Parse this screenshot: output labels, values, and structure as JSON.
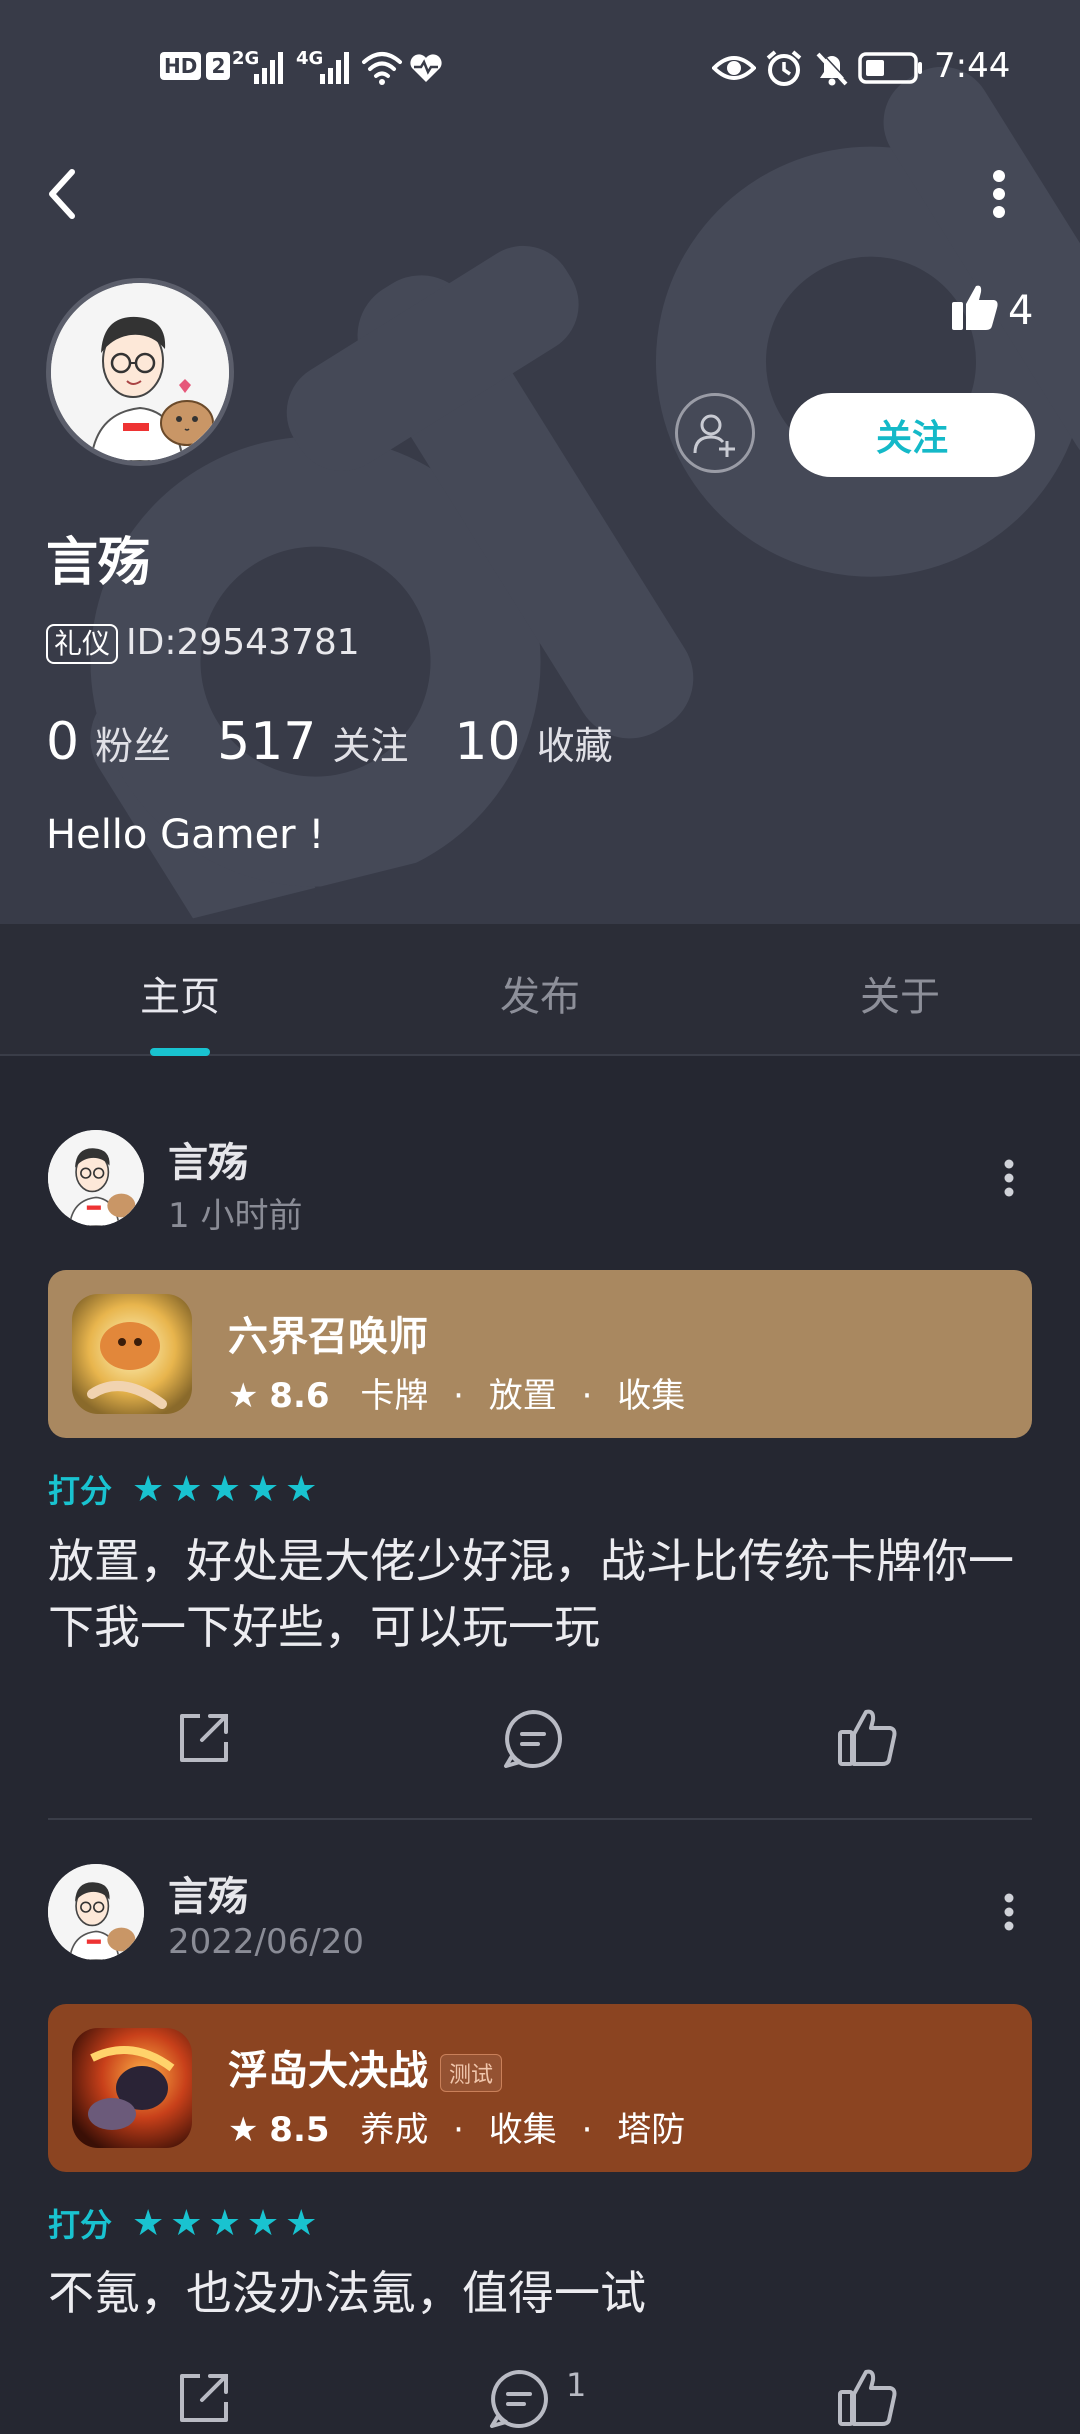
{
  "status_bar": {
    "hd_label": "HD",
    "hd_sub": "2",
    "net1": "2G",
    "net2": "4G",
    "time": "7:44"
  },
  "profile": {
    "name": "言殇",
    "badge": "礼仪",
    "id_text": "ID:29543781",
    "likes": "4",
    "follow_label": "关注",
    "stats": [
      {
        "num": "0",
        "label": "粉丝"
      },
      {
        "num": "517",
        "label": "关注"
      },
      {
        "num": "10",
        "label": "收藏"
      }
    ],
    "bio": "Hello Gamer !"
  },
  "tabs": [
    {
      "label": "主页",
      "active": true
    },
    {
      "label": "发布",
      "active": false
    },
    {
      "label": "关于",
      "active": false
    }
  ],
  "posts": [
    {
      "author": "言殇",
      "time": "1 小时前",
      "game": {
        "title": "六界召唤师",
        "score": "8.6",
        "tags": [
          "卡牌",
          "放置",
          "收集"
        ],
        "tag_extra": ""
      },
      "rating_label": "打分",
      "rating_stars": 5,
      "body": "放置，好处是大佬少好混，战斗比传统卡牌你一下我一下好些，可以玩一玩",
      "card_color": "#a98860"
    },
    {
      "author": "言殇",
      "time": "2022/06/20",
      "game": {
        "title": "浮岛大决战",
        "score": "8.5",
        "tags": [
          "养成",
          "收集",
          "塔防"
        ],
        "tag_extra": "测试"
      },
      "rating_label": "打分",
      "rating_stars": 5,
      "body": "不氪，也没办法氪，值得一试",
      "comment_count": "1",
      "card_color": "#8b4421"
    }
  ],
  "colors": {
    "accent": "#19c3d0",
    "header_bg": "#383b48",
    "page_bg": "#252731"
  }
}
